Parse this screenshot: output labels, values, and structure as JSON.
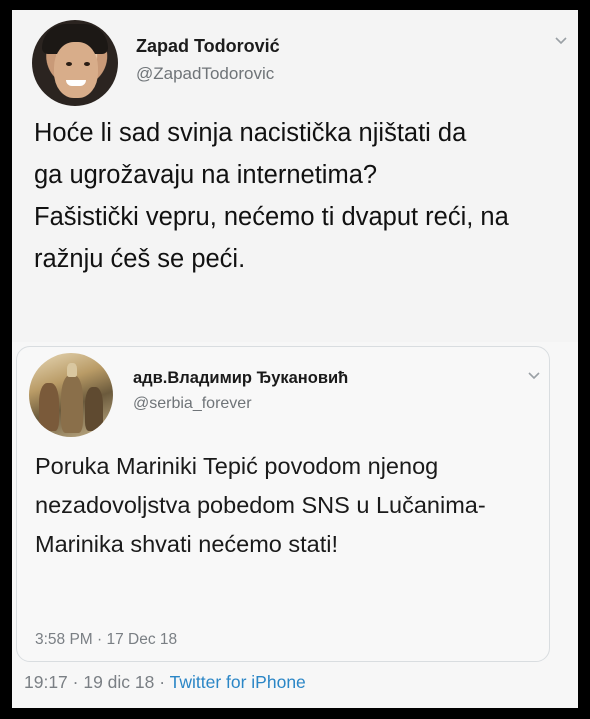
{
  "tweet": {
    "author_name": "Zapad Todorović",
    "author_handle": "@ZapadTodorovic",
    "text_para1": "Hoće li sad svinja nacistička njištati da ga ugrožavaju na internetima?",
    "text_para2": "Fašistički vepru, nećemo ti dvaput reći, na ražnju ćeš se peći.",
    "timestamp": "19:17 · 19 dic 18 · ",
    "source": "Twitter for iPhone",
    "menu_icon": "chevron-down-icon"
  },
  "quoted_tweet": {
    "author_name": "адв.Владимир Ђукановић",
    "author_handle": "@serbia_forever",
    "text": "Poruka Mariniki Tepić povodom njenog nezadovoljstva pobedom SNS u Lučanima- Marinika shvati nećemo stati!",
    "timestamp": "3:58 PM · 17 Dec 18",
    "menu_icon": "chevron-down-icon"
  },
  "colors": {
    "link": "#2b86c6",
    "secondary_text": "#6f7478",
    "frame": "#000000"
  }
}
